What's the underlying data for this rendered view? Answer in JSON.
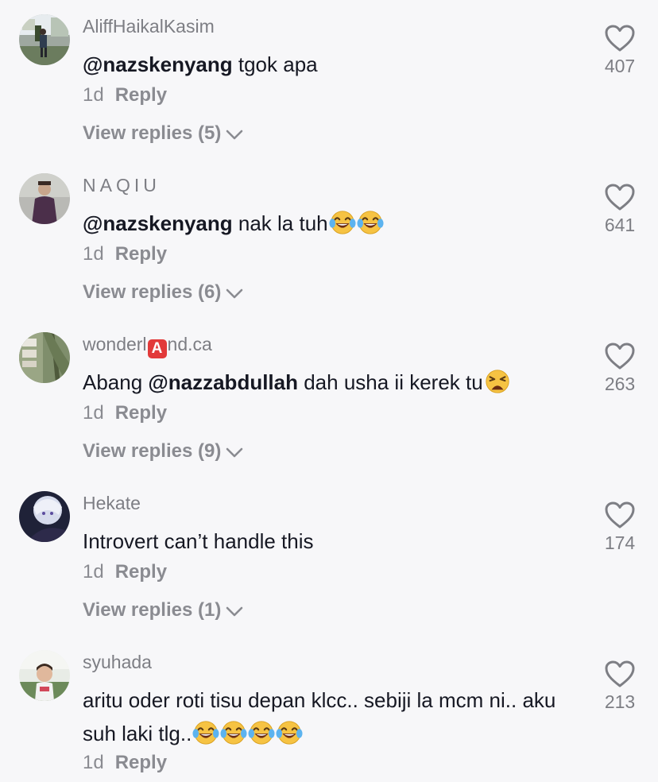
{
  "comments": [
    {
      "username": "AliffHaikalKasim",
      "mention": "@nazskenyang",
      "text": " tgok apa",
      "time": "1d",
      "reply_label": "Reply",
      "view_replies": "View replies (5)",
      "likes": "407"
    },
    {
      "username": "NAQIU",
      "mention": "@nazskenyang",
      "text": " nak la tuh",
      "time": "1d",
      "reply_label": "Reply",
      "view_replies": "View replies (6)",
      "likes": "641"
    },
    {
      "username_prefix": "wonderl",
      "username_badge": "A",
      "username_suffix": "nd.ca",
      "text_prefix": "Abang ",
      "mention": "@nazzabdullah",
      "text": " dah usha ii kerek tu",
      "time": "1d",
      "reply_label": "Reply",
      "view_replies": "View replies (9)",
      "likes": "263"
    },
    {
      "username": "Hekate",
      "text": "Introvert can’t handle this",
      "time": "1d",
      "reply_label": "Reply",
      "view_replies": "View replies (1)",
      "likes": "174"
    },
    {
      "username": "syuhada",
      "text": "aritu oder roti tisu depan klcc.. sebiji la mcm ni.. aku suh laki tlg..",
      "time": "1d",
      "reply_label": "Reply",
      "likes": "213"
    }
  ],
  "icons": {
    "heart": "heart-outline-icon",
    "chevron": "chevron-down-icon",
    "laugh_emoji": "face-with-tears-of-joy-emoji",
    "weary_emoji": "weary-face-emoji"
  }
}
